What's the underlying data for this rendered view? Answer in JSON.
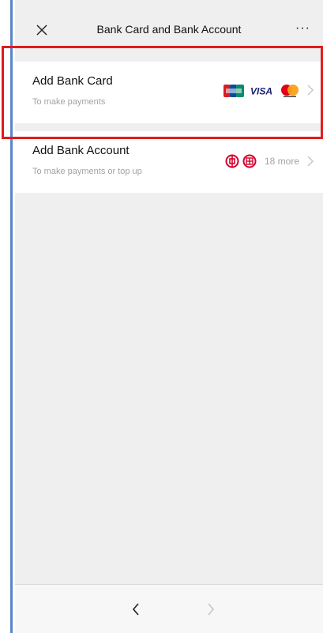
{
  "header": {
    "title": "Bank Card and Bank Account",
    "more_label": "···",
    "close_icon": "close-icon"
  },
  "rows": [
    {
      "title": "Add Bank Card",
      "subtitle": "To make payments",
      "logos": [
        "unionpay-logo",
        "visa-logo",
        "mastercard-logo"
      ],
      "visa_text": "VISA"
    },
    {
      "title": "Add Bank Account",
      "subtitle": "To make payments or top up",
      "logos": [
        "bank-of-china-logo",
        "bank-logo-2"
      ],
      "more_text": "18 more"
    }
  ],
  "bottom_nav": {
    "back_icon": "chevron-left-icon",
    "forward_icon": "chevron-right-icon"
  },
  "colors": {
    "accent_red": "#e11b1b",
    "visa_blue": "#1a1f71",
    "bank_red": "#d4002a"
  }
}
